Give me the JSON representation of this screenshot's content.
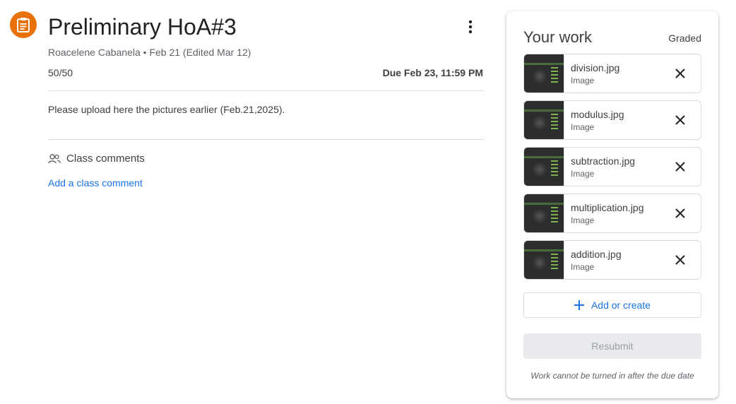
{
  "assignment": {
    "title": "Preliminary HoA#3",
    "meta": "Roacelene Cabanela • Feb 21 (Edited Mar 12)",
    "points": "50/50",
    "due": "Due Feb 23, 11:59 PM",
    "description": "Please upload here the pictures earlier (Feb.21,2025).",
    "icon": "assignment-icon",
    "icon_color": "#e8710a"
  },
  "comments": {
    "label": "Class comments",
    "add_label": "Add a class comment"
  },
  "your_work": {
    "title": "Your work",
    "status": "Graded",
    "files": [
      {
        "name": "division.jpg",
        "type": "Image"
      },
      {
        "name": "modulus.jpg",
        "type": "Image"
      },
      {
        "name": "subtraction.jpg",
        "type": "Image"
      },
      {
        "name": "multiplication.jpg",
        "type": "Image"
      },
      {
        "name": "addition.jpg",
        "type": "Image"
      }
    ],
    "add_create_label": "Add or create",
    "resubmit_label": "Resubmit",
    "note": "Work cannot be turned in after the due date"
  },
  "colors": {
    "accent": "#1a73e8",
    "text": "#3c4043"
  }
}
